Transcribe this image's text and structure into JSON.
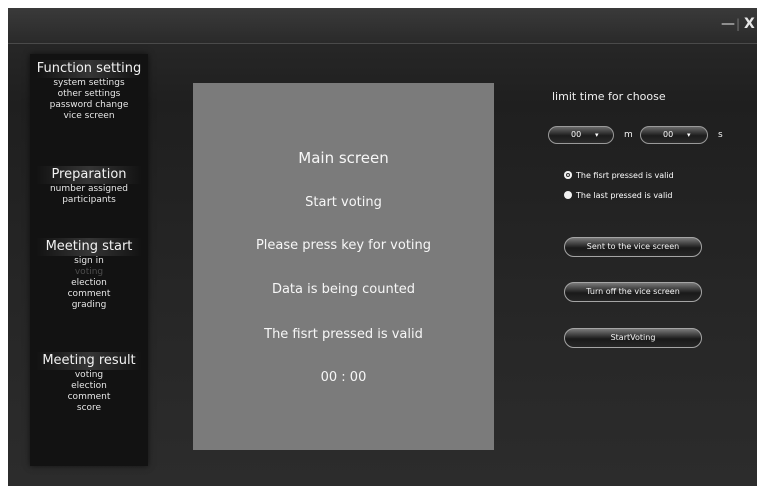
{
  "window": {
    "minimize_label": "—",
    "separator": "|",
    "close_label": "X"
  },
  "sidebar": {
    "function_setting": {
      "title": "Function setting",
      "items": [
        "system settings",
        "other settings",
        "password change",
        "vice screen"
      ]
    },
    "preparation": {
      "title": "Preparation",
      "items": [
        "number assigned",
        "participants"
      ]
    },
    "meeting_start": {
      "title": "Meeting start",
      "items": [
        "sign in",
        "voting",
        "election",
        "comment",
        "grading"
      ]
    },
    "meeting_result": {
      "title": "Meeting result",
      "items": [
        "voting",
        "election",
        "comment",
        "score"
      ]
    }
  },
  "main_screen": {
    "title": "Main screen",
    "line_start": "Start voting",
    "line_press": "Please press key for voting",
    "line_counted": "Data is being counted",
    "line_first": "The fisrt pressed is valid",
    "timer": "00 : 00"
  },
  "right_panel": {
    "limit_label": "limit time for choose",
    "minutes_value": "00",
    "seconds_value": "00",
    "dropdown_arrow": "▾",
    "unit_m": "m",
    "unit_s": "s",
    "radio_first_label": "The fisrt pressed is valid",
    "radio_last_label": "The last pressed is valid",
    "radio_selected": "first",
    "btn_sent_label": "Sent to the vice screen",
    "btn_turnoff_label": "Turn off the vice screen",
    "btn_start_label": "StartVoting"
  },
  "colors": {
    "window_bg": "#262626",
    "main_panel_bg": "#7b7b7b",
    "sidebar_bg": "#121212",
    "text": "#f2f2f2",
    "disabled_text": "#4d4d4d"
  }
}
